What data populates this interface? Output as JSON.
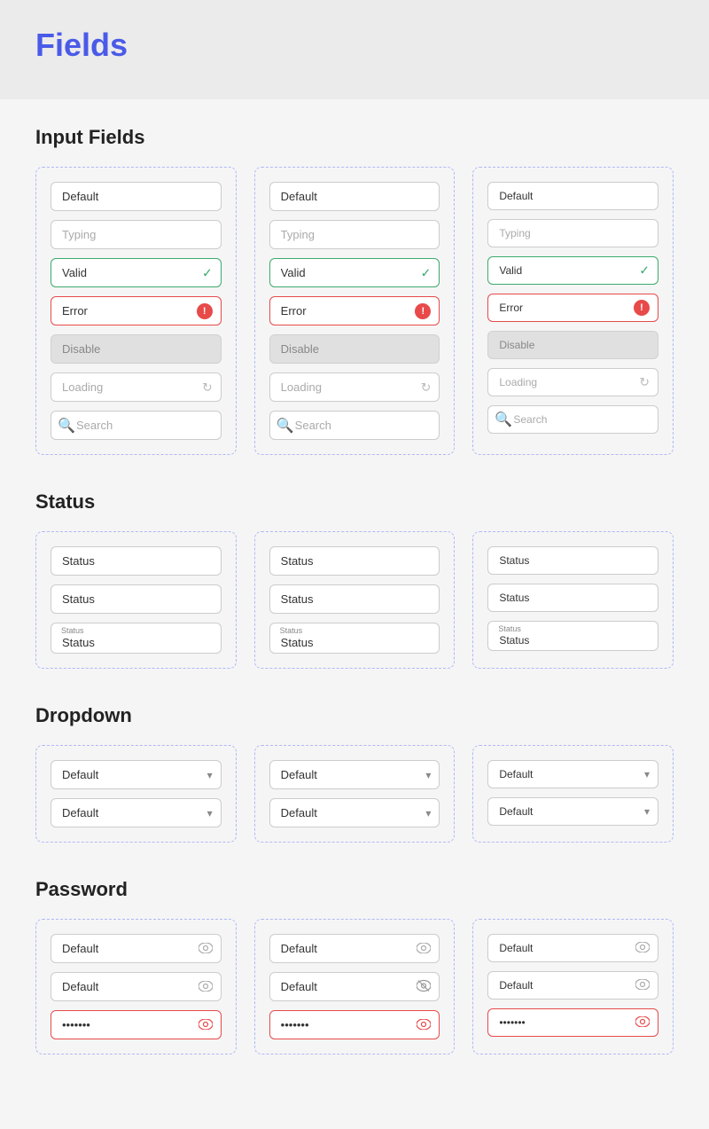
{
  "page": {
    "title": "Fields"
  },
  "sections": {
    "input_fields": {
      "label": "Input Fields",
      "columns": [
        {
          "fields": [
            {
              "type": "default",
              "value": "Default",
              "placeholder": ""
            },
            {
              "type": "typing",
              "value": "",
              "placeholder": "Typing"
            },
            {
              "type": "valid",
              "value": "Valid",
              "placeholder": ""
            },
            {
              "type": "error",
              "value": "Error",
              "placeholder": ""
            },
            {
              "type": "disabled",
              "value": "Disable",
              "placeholder": ""
            },
            {
              "type": "loading",
              "value": "Loading",
              "placeholder": ""
            },
            {
              "type": "search",
              "value": "",
              "placeholder": "Search"
            }
          ]
        },
        {
          "fields": [
            {
              "type": "default",
              "value": "Default",
              "placeholder": ""
            },
            {
              "type": "typing",
              "value": "",
              "placeholder": "Typing"
            },
            {
              "type": "valid",
              "value": "Valid",
              "placeholder": ""
            },
            {
              "type": "error",
              "value": "Error",
              "placeholder": ""
            },
            {
              "type": "disabled",
              "value": "Disable",
              "placeholder": ""
            },
            {
              "type": "loading",
              "value": "Loading",
              "placeholder": ""
            },
            {
              "type": "search",
              "value": "",
              "placeholder": "Search"
            }
          ]
        },
        {
          "fields": [
            {
              "type": "default",
              "value": "Default",
              "placeholder": ""
            },
            {
              "type": "typing",
              "value": "",
              "placeholder": "Typing"
            },
            {
              "type": "valid",
              "value": "Valid",
              "placeholder": ""
            },
            {
              "type": "error",
              "value": "Error",
              "placeholder": ""
            },
            {
              "type": "disabled",
              "value": "Disable",
              "placeholder": ""
            },
            {
              "type": "loading",
              "value": "Loading",
              "placeholder": ""
            },
            {
              "type": "search",
              "value": "",
              "placeholder": "Search"
            }
          ]
        }
      ]
    },
    "status": {
      "label": "Status",
      "columns": [
        {
          "fields": [
            {
              "type": "plain",
              "value": "Status"
            },
            {
              "type": "plain",
              "value": "Status"
            },
            {
              "type": "labeled",
              "label": "Status",
              "value": "Status"
            }
          ]
        },
        {
          "fields": [
            {
              "type": "plain",
              "value": "Status"
            },
            {
              "type": "plain",
              "value": "Status"
            },
            {
              "type": "labeled",
              "label": "Status",
              "value": "Status"
            }
          ]
        },
        {
          "fields": [
            {
              "type": "plain",
              "value": "Status"
            },
            {
              "type": "plain",
              "value": "Status"
            },
            {
              "type": "labeled",
              "label": "Status",
              "value": "Status"
            }
          ]
        }
      ]
    },
    "dropdown": {
      "label": "Dropdown",
      "columns": [
        {
          "fields": [
            {
              "value": "Default"
            },
            {
              "value": "Default"
            }
          ]
        },
        {
          "fields": [
            {
              "value": "Default"
            },
            {
              "value": "Default"
            }
          ]
        },
        {
          "fields": [
            {
              "value": "Default"
            },
            {
              "value": "Default"
            }
          ]
        }
      ]
    },
    "password": {
      "label": "Password",
      "columns": [
        {
          "fields": [
            {
              "type": "normal",
              "value": "Default",
              "icon": "eye"
            },
            {
              "type": "normal",
              "value": "Default",
              "icon": "eye"
            },
            {
              "type": "error",
              "value": "•••••••",
              "icon": "eye"
            }
          ]
        },
        {
          "fields": [
            {
              "type": "normal",
              "value": "Default",
              "icon": "eye"
            },
            {
              "type": "normal",
              "value": "Default",
              "icon": "eye-slash"
            },
            {
              "type": "error",
              "value": "•••••••",
              "icon": "eye"
            }
          ]
        },
        {
          "fields": [
            {
              "type": "normal",
              "value": "Default",
              "icon": "eye"
            },
            {
              "type": "normal",
              "value": "Default",
              "icon": "eye"
            },
            {
              "type": "error",
              "value": "•••••••",
              "icon": "eye"
            }
          ]
        }
      ]
    }
  }
}
